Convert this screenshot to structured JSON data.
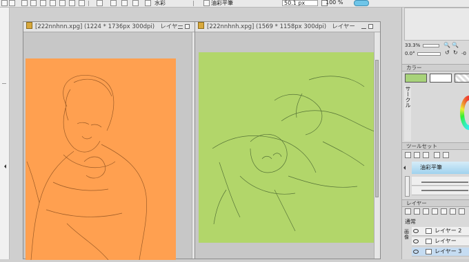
{
  "toolbar": {
    "brush_name": "水彩",
    "brush_preset": "油彩平筆",
    "size_value": "50.1 px",
    "opacity_value": "100 %"
  },
  "canvas_windows": [
    {
      "title": "[222nnhnn.xpg] (1224 * 1736px 300dpi)",
      "layer_suffix": "レイヤー",
      "canvas_color": "#ffa050"
    },
    {
      "title": "[222nnhnh.xpg] (1569 * 1158px 300dpi)",
      "layer_suffix": "レイヤー",
      "canvas_color": "#b2d66a"
    }
  ],
  "navigator": {
    "zoom_value": "33.3%",
    "angle_value": "0.0°",
    "angle_right": "-0"
  },
  "color_panel": {
    "title": "カラー",
    "circle_label": "サークル",
    "main_color": "#a8d37a"
  },
  "toolset_panel": {
    "title": "ツールセット",
    "selected_tool": "油彩平筆"
  },
  "layer_panel": {
    "title": "レイヤー",
    "blend_mode": "通常",
    "opacity_label": "画像",
    "layers": [
      {
        "name": "レイヤー 2"
      },
      {
        "name": "レイヤー"
      },
      {
        "name": "レイヤー 3"
      }
    ]
  }
}
